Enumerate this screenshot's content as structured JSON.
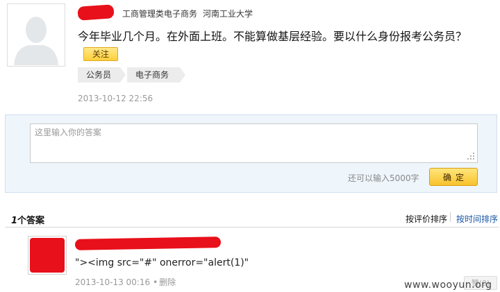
{
  "question": {
    "meta_category": "工商管理类电子商务",
    "meta_school": "河南工业大学",
    "title": "今年毕业几个月。在外面上班。不能算做基层经验。要以什么身份报考公务员？",
    "follow_label": "关注",
    "tags": [
      "公务员",
      "电子商务"
    ],
    "time": "2013-10-12 22:56"
  },
  "answer_box": {
    "placeholder": "这里输入你的答案",
    "remaining_text": "还可以输入5000字",
    "confirm_label": "确定"
  },
  "answers_header": {
    "count_num": "1",
    "count_label": "个答案",
    "sort_by_rating": "按评价排序",
    "sort_by_time": "按时间排序"
  },
  "answers": [
    {
      "text": "\"><img src=\"#\" onerror=\"alert(1)\"",
      "time": "2013-10-13 00:16",
      "delete_label": "删除",
      "like_label": "赞(0)"
    }
  ],
  "watermark": "www.wooyun.org",
  "colors": {
    "redaction": "#e8101a",
    "accent_button": "#f7c22c",
    "link_blue": "#1a57a8",
    "panel_bg": "#eef5fb"
  }
}
